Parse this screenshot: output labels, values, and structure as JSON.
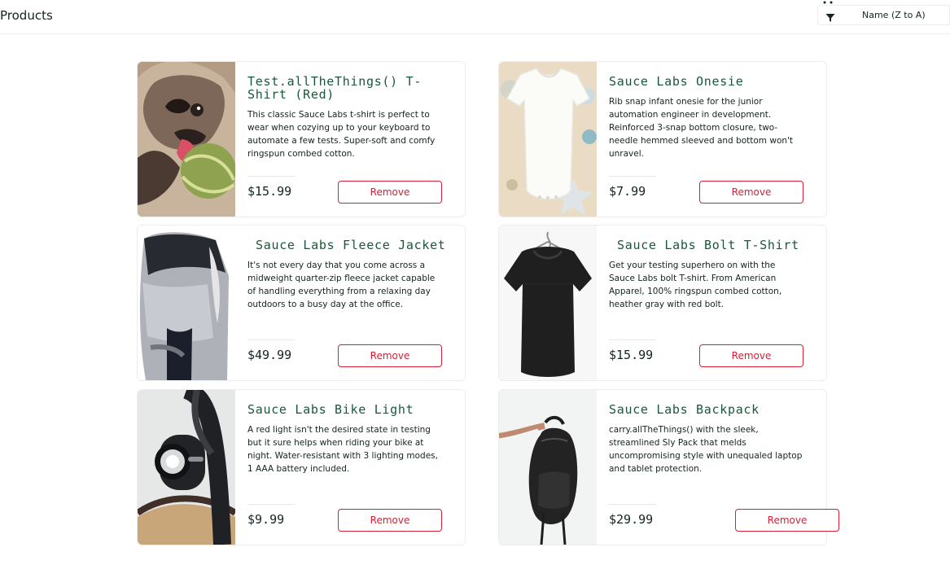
{
  "header": {
    "title": "Products",
    "cart_icon": "shopping-cart-icon",
    "sort": {
      "icon": "filter-icon",
      "selected": "Name (Z to A)"
    }
  },
  "products": [
    {
      "name": "Test.allTheThings() T-Shirt (Red)",
      "description": "This classic Sauce Labs t-shirt is perfect to wear when cozying up to your keyboard to automate a few tests. Super-soft and comfy ringspun combed cotton.",
      "price": "$15.99",
      "button": "Remove",
      "image": "pug-with-ball"
    },
    {
      "name": "Sauce Labs Onesie",
      "description": "Rib snap infant onesie for the junior automation engineer in development. Reinforced 3-snap bottom closure, two-needle hemmed sleeved and bottom won't unravel.",
      "price": "$7.99",
      "button": "Remove",
      "image": "white-onesie"
    },
    {
      "name": "Sauce Labs Fleece Jacket",
      "description": "It's not every day that you come across a midweight quarter-zip fleece jacket capable of handling everything from a relaxing day outdoors to a busy day at the office.",
      "price": "$49.99",
      "button": "Remove",
      "image": "grey-fleece-jacket"
    },
    {
      "name": "Sauce Labs Bolt T-Shirt",
      "description": "Get your testing superhero on with the Sauce Labs bolt T-shirt. From American Apparel, 100% ringspun combed cotton, heather gray with red bolt.",
      "price": "$15.99",
      "button": "Remove",
      "image": "black-t-shirt"
    },
    {
      "name": "Sauce Labs Bike Light",
      "description": "A red light isn't the desired state in testing but it sure helps when riding your bike at night. Water-resistant with 3 lighting modes, 1 AAA battery included.",
      "price": "$9.99",
      "button": "Remove",
      "image": "bike-light"
    },
    {
      "name": "Sauce Labs Backpack",
      "description": "carry.allTheThings() with the sleek, streamlined Sly Pack that melds uncompromising style with unequaled laptop and tablet protection.",
      "price": "$29.99",
      "button": "Remove",
      "image": "black-backpack"
    }
  ]
}
